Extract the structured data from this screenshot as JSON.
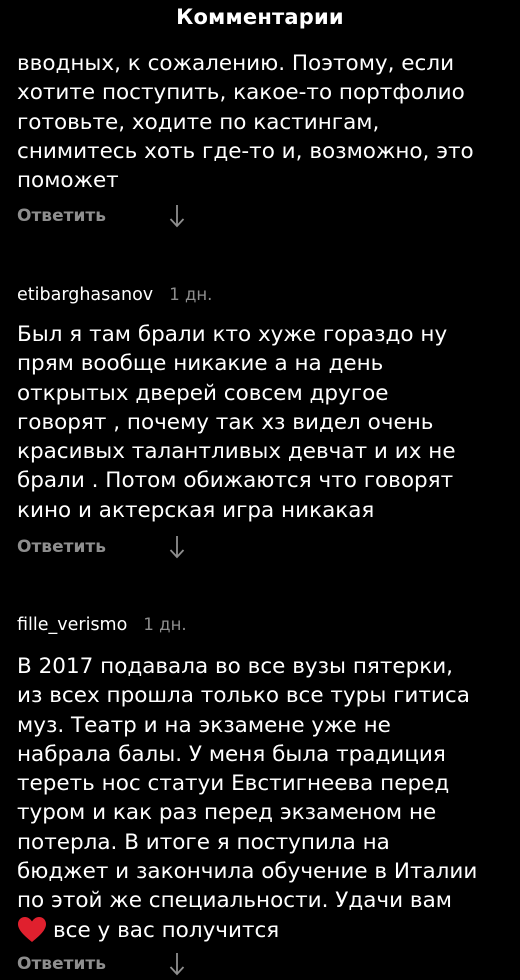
{
  "header": {
    "title": "Комментарии"
  },
  "comments": [
    {
      "text_lines": [
        "вводных, к сожалению. Поэтому, если",
        "хотите поступить, какое-то портфолио",
        "готовьте, ходите по кастингам,",
        "снимитесь хоть где-то и, возможно, это",
        "поможет"
      ],
      "reply_label": "Ответить"
    },
    {
      "username": "etibarghasanov",
      "time": "1 дн.",
      "text_lines": [
        "Был я там брали кто хуже гораздо ну",
        "прям вообще никакие а на день",
        "открытых дверей совсем  другое",
        "говорят , почему так хз видел очень",
        "красивых талантливых девчат и их не",
        "брали . Потом обижаются что говорят",
        "кино и актерская игра никакая"
      ],
      "reply_label": "Ответить"
    },
    {
      "username": "fille_verismo",
      "time": "1 дн.",
      "text_lines": [
        "В 2017 подавала во все вузы пятерки,",
        "из всех прошла только все туры гитиса",
        "муз. Театр и на экзамене уже не",
        "набрала балы. У меня была традиция",
        "тереть нос статуи Евстигнеева перед",
        "туром и как раз перед экзаменом не",
        "потерла. В итоге я поступила  на",
        "бюджет и закончила обучение в Италии",
        "по этой же специальности. Удачи вам",
        "все у вас получится"
      ],
      "emoji_icon": "red-heart-icon",
      "reply_label": "Ответить"
    }
  ],
  "colors": {
    "background": "#000000",
    "text": "#ffffff",
    "secondary": "#8e8e8e",
    "heart": "#e0202e"
  }
}
